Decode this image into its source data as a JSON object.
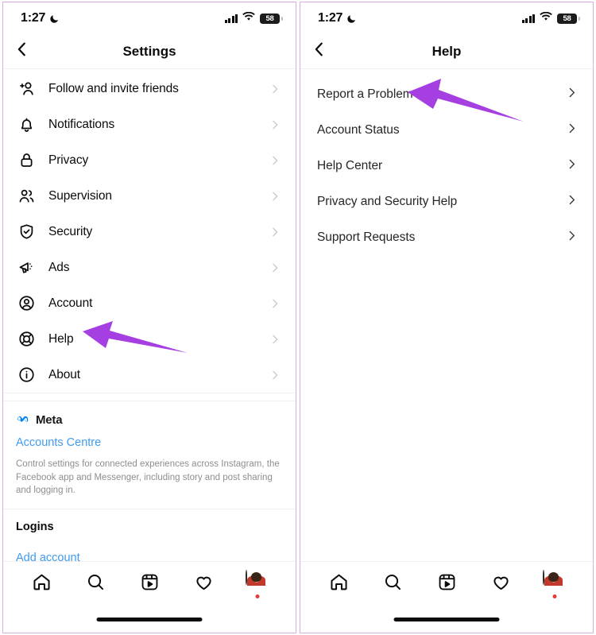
{
  "status_bar": {
    "time": "1:27",
    "moon_icon": "crescent-moon-icon",
    "signal_icon": "cellular-signal-icon",
    "wifi_icon": "wifi-icon",
    "battery_level": "58"
  },
  "colors": {
    "accent_blue": "#3f9bf0",
    "annotation_purple": "#A63FE1",
    "frame_border": "#d9aee0",
    "text_primary": "#0b0b0b",
    "text_secondary": "#8e8e8e",
    "chevron": "#c7c7c7",
    "badge_red": "#e23b3b"
  },
  "settings_screen": {
    "nav": {
      "back_icon": "chevron-left-icon",
      "title": "Settings"
    },
    "items": [
      {
        "label": "Follow and invite friends",
        "icon": "add-person-icon"
      },
      {
        "label": "Notifications",
        "icon": "bell-icon"
      },
      {
        "label": "Privacy",
        "icon": "lock-icon"
      },
      {
        "label": "Supervision",
        "icon": "people-icon"
      },
      {
        "label": "Security",
        "icon": "shield-check-icon"
      },
      {
        "label": "Ads",
        "icon": "megaphone-icon"
      },
      {
        "label": "Account",
        "icon": "person-circle-icon"
      },
      {
        "label": "Help",
        "icon": "lifebuoy-icon"
      },
      {
        "label": "About",
        "icon": "info-circle-icon"
      }
    ],
    "meta": {
      "logo_icon": "meta-infinity-icon",
      "brand": "Meta",
      "link": "Accounts Centre",
      "description": "Control settings for connected experiences across Instagram, the Facebook app and Messenger, including story and post sharing and logging in."
    },
    "logins": {
      "title": "Logins",
      "add_account": "Add account"
    }
  },
  "help_screen": {
    "nav": {
      "back_icon": "chevron-left-icon",
      "title": "Help"
    },
    "items": [
      {
        "label": "Report a Problem"
      },
      {
        "label": "Account Status"
      },
      {
        "label": "Help Center"
      },
      {
        "label": "Privacy and Security Help"
      },
      {
        "label": "Support Requests"
      }
    ]
  },
  "tab_bar": {
    "tabs": [
      {
        "icon": "home-icon",
        "name": "home"
      },
      {
        "icon": "search-icon",
        "name": "search"
      },
      {
        "icon": "reels-icon",
        "name": "reels"
      },
      {
        "icon": "heart-icon",
        "name": "activity"
      },
      {
        "icon": "profile-avatar-icon",
        "name": "profile"
      }
    ]
  },
  "annotations": [
    {
      "name": "arrow-pointing-to-help",
      "target": "Help"
    },
    {
      "name": "arrow-pointing-to-report-a-problem",
      "target": "Report a Problem"
    }
  ]
}
